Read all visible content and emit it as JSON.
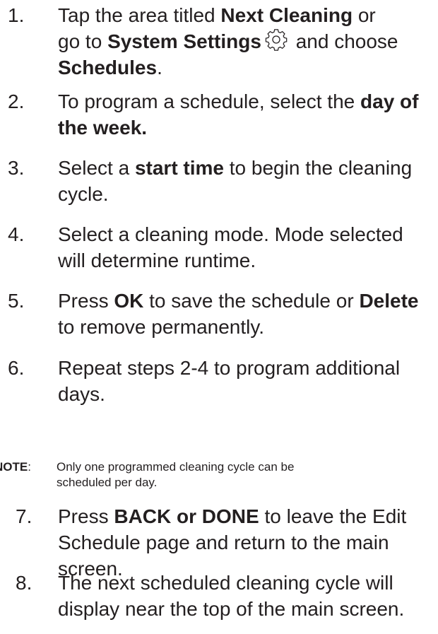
{
  "steps": [
    {
      "number": "1.",
      "lines": [
        [
          {
            "t": "Tap the area titled ",
            "b": false
          },
          {
            "t": "Next Cleaning",
            "b": true
          },
          {
            "t": " or",
            "b": false
          }
        ],
        [
          {
            "t": "go to ",
            "b": false
          },
          {
            "t": "System Settings",
            "b": true
          },
          {
            "icon": "gear-icon"
          },
          {
            "t": " and choose",
            "b": false
          }
        ],
        [
          {
            "t": "Schedules",
            "b": true
          },
          {
            "t": ".",
            "b": false
          }
        ]
      ]
    },
    {
      "number": "2.",
      "lines": [
        [
          {
            "t": "To program a schedule, select the ",
            "b": false
          },
          {
            "t": "day of",
            "b": true
          }
        ],
        [
          {
            "t": "the week.",
            "b": true
          }
        ]
      ]
    },
    {
      "number": "3.",
      "lines": [
        [
          {
            "t": "Select a ",
            "b": false
          },
          {
            "t": "start time",
            "b": true
          },
          {
            "t": " to begin the cleaning",
            "b": false
          }
        ],
        [
          {
            "t": "cycle.",
            "b": false
          }
        ]
      ]
    },
    {
      "number": "4.",
      "lines": [
        [
          {
            "t": "Select a cleaning mode. Mode selected",
            "b": false
          }
        ],
        [
          {
            "t": "will determine runtime.",
            "b": false
          }
        ]
      ]
    },
    {
      "number": "5.",
      "lines": [
        [
          {
            "t": "Press ",
            "b": false
          },
          {
            "t": "OK",
            "b": true
          },
          {
            "t": " to save the schedule or ",
            "b": false
          },
          {
            "t": "Delete",
            "b": true
          }
        ],
        [
          {
            "t": "to remove permanently.",
            "b": false
          }
        ]
      ]
    },
    {
      "number": "6.",
      "lines": [
        [
          {
            "t": "Repeat steps 2-4 to program additional",
            "b": false
          }
        ],
        [
          {
            "t": "days.",
            "b": false
          }
        ]
      ]
    },
    {
      "number": "7.",
      "lines": [
        [
          {
            "t": "Press ",
            "b": false
          },
          {
            "t": "BACK or DONE",
            "b": true
          },
          {
            "t": " to leave the Edit",
            "b": false
          }
        ],
        [
          {
            "t": "Schedule page and return to the main",
            "b": false
          }
        ],
        [
          {
            "t": "screen.",
            "b": false
          }
        ]
      ]
    },
    {
      "number": "8.",
      "lines": [
        [
          {
            "t": "The next scheduled cleaning cycle will",
            "b": false
          }
        ],
        [
          {
            "t": "display near the top of the main screen.",
            "b": false
          }
        ]
      ]
    }
  ],
  "note": {
    "label": "NOTE",
    "colon": ":",
    "line1": "Only one programmed cleaning cycle can be",
    "line2": "scheduled per day."
  }
}
